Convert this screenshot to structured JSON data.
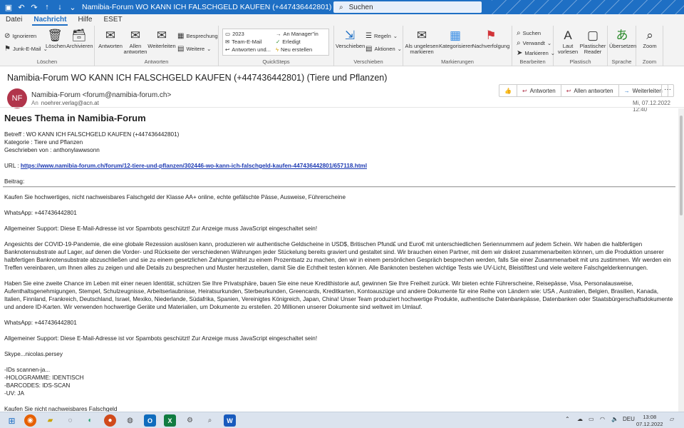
{
  "window": {
    "title": "Namibia-Forum WO KANN ICH FALSCHGELD KAUFEN (+447436442801) (Tiere und Pflanzen)  -  Nachricht (HTML)",
    "search_placeholder": "Suchen"
  },
  "menu": {
    "datei": "Datei",
    "nachricht": "Nachricht",
    "hilfe": "Hilfe",
    "eset": "ESET"
  },
  "ribbon": {
    "loeschen_group": {
      "ignorieren": "Ignorieren",
      "junk": "Junk-E-Mail",
      "loeschen": "Löschen",
      "archivieren": "Archivieren",
      "label": "Löschen"
    },
    "antworten_group": {
      "antworten": "Antworten",
      "allen_antworten": "Allen antworten",
      "weiterleiten": "Weiterleiten",
      "besprechung": "Besprechung",
      "weitere": "Weitere",
      "label": "Antworten"
    },
    "quicksteps": {
      "items": [
        "2023",
        "Team-E-Mail",
        "Antworten und...",
        "An Manager\"in",
        "Erledigt",
        "Neu erstellen"
      ],
      "label": "QuickSteps"
    },
    "verschieben_group": {
      "verschieben": "Verschieben",
      "regeln": "Regeln",
      "aktionen": "Aktionen",
      "label": "Verschieben"
    },
    "markierungen_group": {
      "ungelesen": "Als ungelesen markieren",
      "kategorisieren": "Kategorisieren",
      "nachverfolgung": "Nachverfolgung",
      "label": "Markierungen"
    },
    "bearbeiten_group": {
      "suchen": "Suchen",
      "verwandt": "Verwandt",
      "markieren": "Markieren",
      "label": "Bearbeiten"
    },
    "plastisch_group": {
      "laut": "Laut vorlesen",
      "reader": "Plastischer Reader",
      "label": "Plastisch"
    },
    "sprache_group": {
      "uebersetzen": "Übersetzen",
      "label": "Sprache"
    },
    "zoom_group": {
      "zoom": "Zoom",
      "label": "Zoom"
    }
  },
  "message": {
    "subject": "Namibia-Forum WO KANN ICH FALSCHGELD KAUFEN (+447436442801) (Tiere und Pflanzen)",
    "avatar_initials": "NF",
    "from": "Namibia-Forum <forum@namibia-forum.ch>",
    "to_label": "An",
    "to": "noehrer.verlag@acn.at",
    "date": "Mi, 07.12.2022 12:40",
    "actions": {
      "antworten": "Antworten",
      "allen_antworten": "Allen antworten",
      "weiterleiten": "Weiterleiten"
    }
  },
  "body": {
    "heading": "Neues Thema in Namibia-Forum",
    "betreff": "Betreff : WO KANN ICH FALSCHGELD KAUFEN (+447436442801)",
    "kategorie": "Kategorie : Tiere und Pflanzen",
    "geschrieben": "Geschrieben von : anthonylawwsonn",
    "url_label": "URL :",
    "url": "https://www.namibia-forum.ch/forum/12-tiere-und-pflanzen/302446-wo-kann-ich-falschgeld-kaufen-447436442801/657118.html",
    "beitrag_label": "Beitrag:",
    "p1": "Kaufen Sie hochwertiges, nicht nachweisbares Falschgeld der Klasse AA+ online, echte gefälschte Pässe, Ausweise, Führerscheine",
    "p2": "WhatsApp: +447436442801",
    "p3": "Allgemeiner Support: Diese E-Mail-Adresse ist vor Spambots geschützt! Zur Anzeige muss JavaScript eingeschaltet sein!",
    "p4": "Angesichts der COVID-19-Pandemie, die eine globale Rezession auslösen kann, produzieren wir authentische Geldscheine in USD$, Britischen Pfund£ und Euro€ mit unterschiedlichen Seriennummern auf jedem Schein. Wir haben die halbfertigen Banknotensubstrate auf Lager, auf denen die Vorder- und Rückseite der verschiedenen Währungen jeder Stückelung bereits graviert und gestaltet sind. Wir brauchen einen Partner, mit dem wir diskret zusammenarbeiten können, um die Produktion unserer halbfertigen Banknotensubstrate abzuschließen und sie zu einem gesetzlichen Zahlungsmittel zu einem Prozentsatz zu machen, den wir in einem persönlichen Gespräch besprechen werden, falls Sie einer Zusammenarbeit mit uns zustimmen. Wir werden ein Treffen vereinbaren, um Ihnen alles zu zeigen und alle Details zu besprechen und Muster herzustellen, damit Sie die Echtheit testen können. Alle Banknoten bestehen wichtige Tests wie UV-Licht, Bleistifttest und viele weitere Falschgelderkennungen.",
    "p5": "Haben Sie eine zweite Chance im Leben mit einer neuen Identität, schützen Sie Ihre Privatsphäre, bauen Sie eine neue Kredithistorie auf, gewinnen Sie Ihre Freiheit zurück. Wir bieten echte Führerscheine, Reisepässe, Visa, Personalausweise, Aufenthaltsgenehmigungen, Stempel, Schulzeugnisse, Arbeitserlaubnisse, Heiratsurkunden, Sterbeurkunden, Greencards, Kreditkarten, Kontoauszüge und andere Dokumente für eine Reihe von Ländern wie: USA , Australien, Belgien, Brasilien, Kanada, Italien, Finnland, Frankreich, Deutschland, Israel, Mexiko, Niederlande, Südafrika, Spanien, Vereinigtes Königreich, Japan, China! Unser Team produziert hochwertige Produkte, authentische Datenbankpässe, Datenbanken oder Staatsbürgerschaftsdokumente und andere ID-Karten. Wir verwenden hochwertige Geräte und Materialien, um Dokumente zu erstellen. 20 Millionen unserer Dokumente sind weltweit im Umlauf.",
    "p6": "WhatsApp: +447436442801",
    "p7": "Allgemeiner Support: Diese E-Mail-Adresse ist vor Spambots geschützt! Zur Anzeige muss JavaScript eingeschaltet sein!",
    "p8": "Skype...nicolas.persey",
    "list": [
      "-IDs scannen-ja...",
      "-HOLOGRAMME: IDENTISCH",
      "-BARCODES: IDS-SCAN",
      "-UV: JA"
    ],
    "p9": "Kaufen Sie nicht nachweisbares Falschgeld"
  },
  "taskbar": {
    "lang": "DEU",
    "time": "13:08",
    "date": "07.12.2022"
  }
}
